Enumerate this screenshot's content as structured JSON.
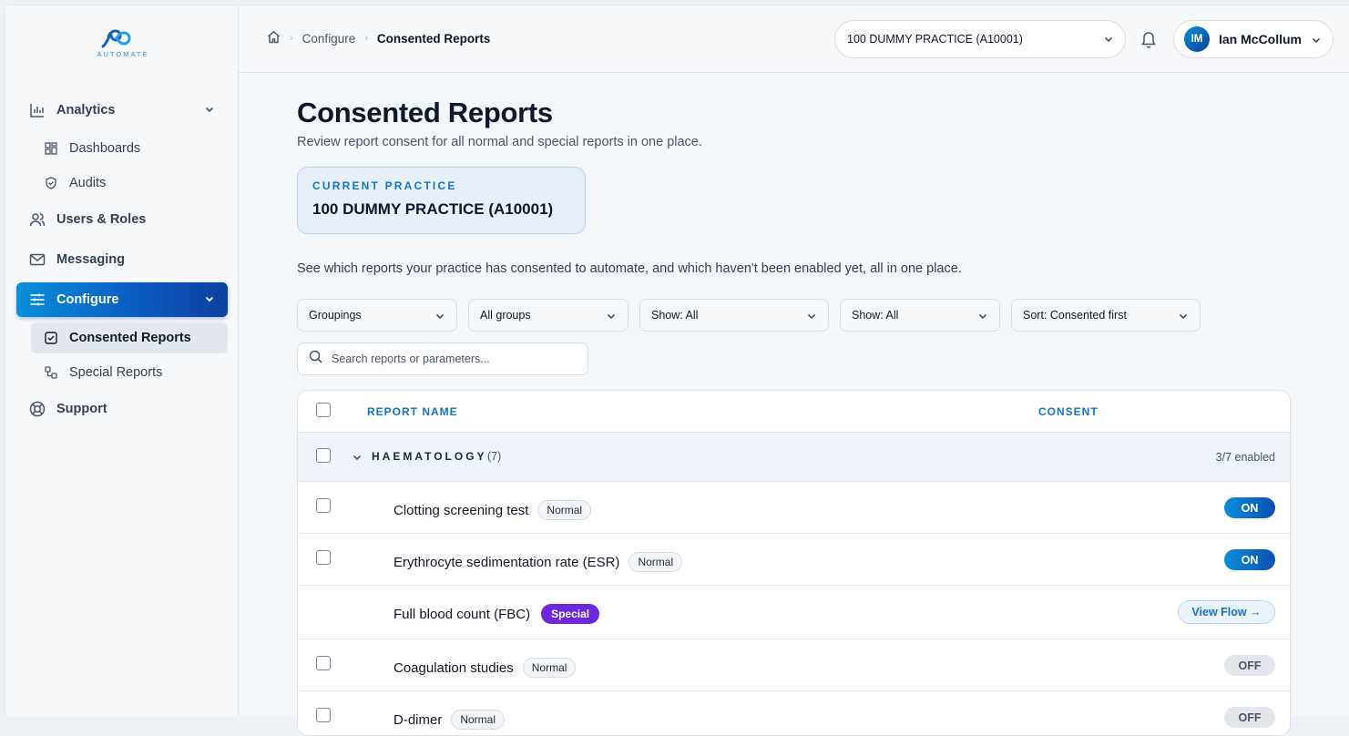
{
  "logo": {
    "text": "AUTOMATE"
  },
  "sidebar": {
    "items": [
      {
        "label": "Analytics",
        "icon": "bar-chart-icon"
      },
      {
        "label": "Dashboards",
        "icon": "grid-icon"
      },
      {
        "label": "Audits",
        "icon": "shield-icon"
      },
      {
        "label": "Users & Roles",
        "icon": "users-icon"
      },
      {
        "label": "Messaging",
        "icon": "mail-icon"
      },
      {
        "label": "Configure",
        "icon": "sliders-icon"
      },
      {
        "label": "Consented Reports",
        "icon": "checkbox-icon"
      },
      {
        "label": "Special Reports",
        "icon": "flow-icon"
      },
      {
        "label": "Support",
        "icon": "lifebuoy-icon"
      }
    ]
  },
  "header": {
    "breadcrumb": {
      "parent": "Configure",
      "current": "Consented Reports"
    },
    "practice_select": "100 DUMMY PRACTICE (A10001)",
    "user": {
      "initials": "IM",
      "name": "Ian McCollum"
    }
  },
  "main": {
    "title": "Consented Reports",
    "subtitle": "Review report consent for all normal and special reports in one place.",
    "practice_card": {
      "label": "CURRENT PRACTICE",
      "value": "100 DUMMY PRACTICE (A10001)"
    },
    "description": "See which reports your practice has consented to automate, and which haven't been enabled yet, all in one place.",
    "filters": [
      "Groupings",
      "All groups",
      "Show: All",
      "Show: All",
      "Sort: Consented first"
    ],
    "search": {
      "placeholder": "Search reports or parameters..."
    }
  },
  "table": {
    "headers": {
      "name": "REPORT NAME",
      "consent": "CONSENT"
    },
    "group": {
      "name": "HAEMATOLOGY",
      "count": "(7)",
      "enabled": "3/7 enabled"
    },
    "rows": [
      {
        "name": "Clotting screening test",
        "badge": "Normal",
        "consent": "ON"
      },
      {
        "name": "Erythrocyte sedimentation rate (ESR)",
        "badge": "Normal",
        "consent": "ON"
      },
      {
        "name": "Full blood count (FBC)",
        "badge": "Special",
        "action": "View Flow →"
      },
      {
        "name": "Coagulation studies",
        "badge": "Normal",
        "consent": "OFF"
      },
      {
        "name": "D-dimer",
        "badge": "Normal",
        "consent": "OFF"
      }
    ]
  },
  "colors": {
    "accent": "#0b5dc2",
    "accent_light": "#1673c6",
    "special": "#6d28d9"
  }
}
